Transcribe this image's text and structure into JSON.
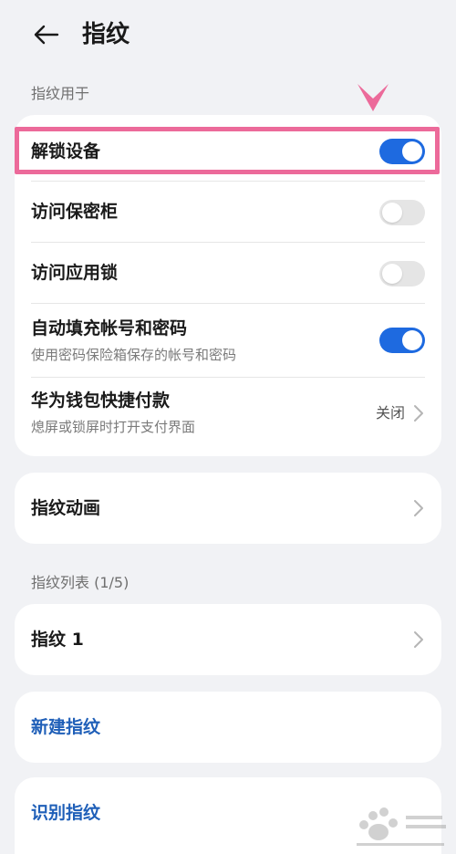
{
  "header": {
    "title": "指纹"
  },
  "sections": {
    "usage_label": "指纹用于",
    "list_label": "指纹列表 (1/5)"
  },
  "usage_items": [
    {
      "title": "解锁设备",
      "toggle": true
    },
    {
      "title": "访问保密柜",
      "toggle": false
    },
    {
      "title": "访问应用锁",
      "toggle": false
    },
    {
      "title": "自动填充帐号和密码",
      "subtitle": "使用密码保险箱保存的帐号和密码",
      "toggle": true
    },
    {
      "title": "华为钱包快捷付款",
      "subtitle": "熄屏或锁屏时打开支付界面",
      "value": "关闭"
    }
  ],
  "animation": {
    "title": "指纹动画"
  },
  "fingerprints": [
    {
      "title": "指纹 1"
    }
  ],
  "actions": {
    "new_fingerprint": "新建指纹",
    "identify_fingerprint": "识别指纹"
  },
  "colors": {
    "accent": "#1e6ae0",
    "link": "#1f5fb8",
    "highlight": "#ec6a9a",
    "background": "#f1f2f5"
  }
}
